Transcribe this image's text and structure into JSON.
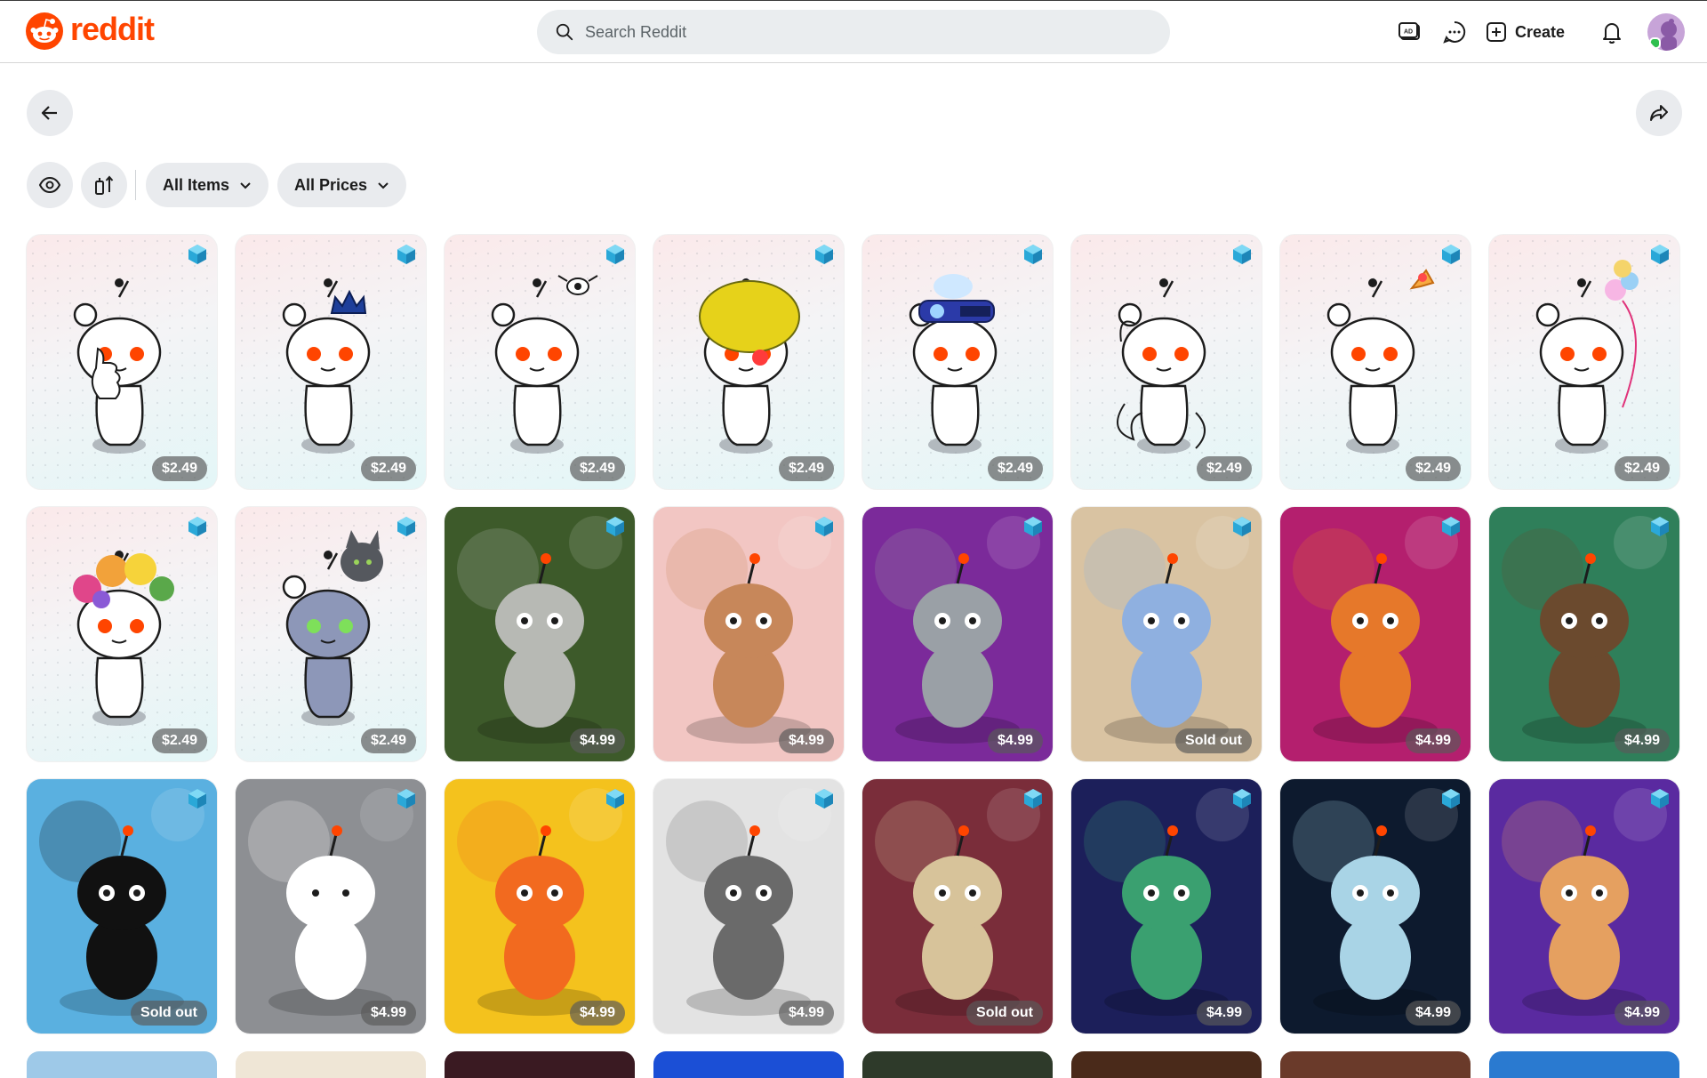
{
  "header": {
    "logo_text": "reddit",
    "search_placeholder": "Search Reddit",
    "create_label": "Create",
    "icons": [
      "advertise-icon",
      "chat-icon",
      "plus-square-icon",
      "bell-icon"
    ]
  },
  "toolbar": {
    "back_icon": "arrow-left-icon",
    "share_icon": "share-icon",
    "eye_icon": "eye-icon",
    "sort_icon": "sort-icon",
    "filter_items_label": "All Items",
    "filter_prices_label": "All Prices"
  },
  "colors": {
    "brand": "#ff4500",
    "button_bg": "#e9ebee",
    "price_badge_bg": "#5a5a5a"
  },
  "items": [
    {
      "label": "$2.49",
      "style": "light",
      "accessory": "thumbs-up"
    },
    {
      "label": "$2.49",
      "style": "light",
      "accessory": "crown"
    },
    {
      "label": "$2.49",
      "style": "light",
      "accessory": "fly"
    },
    {
      "label": "$2.49",
      "style": "light",
      "accessory": "clown-hair"
    },
    {
      "label": "$2.49",
      "style": "light",
      "accessory": "goggles"
    },
    {
      "label": "$2.49",
      "style": "light",
      "accessory": "sketch-mane"
    },
    {
      "label": "$2.49",
      "style": "light",
      "accessory": "hat"
    },
    {
      "label": "$2.49",
      "style": "light",
      "accessory": "balloon"
    },
    {
      "label": "$2.49",
      "style": "light",
      "accessory": "flower-crown"
    },
    {
      "label": "$2.49",
      "style": "light",
      "accessory": "cat-head"
    },
    {
      "label": "$4.99",
      "style": "art",
      "bg": "#3d5a2a",
      "accent": "#b7b9b4"
    },
    {
      "label": "$4.99",
      "style": "art",
      "bg": "#f2c6c3",
      "accent": "#c7875a"
    },
    {
      "label": "$4.99",
      "style": "art",
      "bg": "#7b2a9a",
      "accent": "#9aa0a6"
    },
    {
      "label": "Sold out",
      "style": "art",
      "bg": "#d9c3a2",
      "accent": "#8fb0e0"
    },
    {
      "label": "$4.99",
      "style": "art",
      "bg": "#b41f6e",
      "accent": "#e6782a"
    },
    {
      "label": "$4.99",
      "style": "art",
      "bg": "#2f7f5a",
      "accent": "#6b4a2e"
    },
    {
      "label": "Sold out",
      "style": "art",
      "bg": "#5ab0e0",
      "accent": "#111111"
    },
    {
      "label": "$4.99",
      "style": "art",
      "bg": "#8d8f93",
      "accent": "#ffffff"
    },
    {
      "label": "$4.99",
      "style": "art",
      "bg": "#f4c21d",
      "accent": "#f26a1f"
    },
    {
      "label": "$4.99",
      "style": "art",
      "bg": "#e3e3e3",
      "accent": "#6a6a6a"
    },
    {
      "label": "Sold out",
      "style": "art",
      "bg": "#7a2d3a",
      "accent": "#d7c39a"
    },
    {
      "label": "$4.99",
      "style": "art",
      "bg": "#1c1f5a",
      "accent": "#3aa070"
    },
    {
      "label": "$4.99",
      "style": "art",
      "bg": "#0d1a2e",
      "accent": "#a9d4e6"
    },
    {
      "label": "$4.99",
      "style": "art",
      "bg": "#5a2aa0",
      "accent": "#e5a060"
    }
  ],
  "partial_row_colors": [
    "#9ec9e8",
    "#efe6d6",
    "#3a1a22",
    "#1b4fd6",
    "#2e3a2a",
    "#4a2a1a",
    "#6a3a2a",
    "#2a7ad0"
  ]
}
